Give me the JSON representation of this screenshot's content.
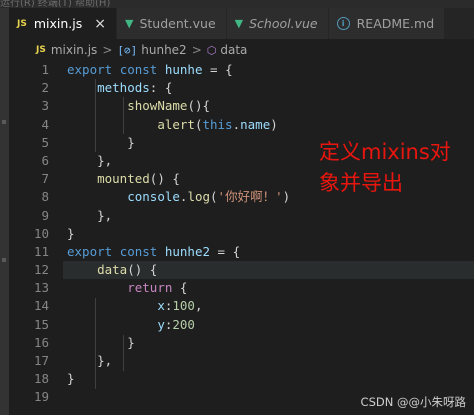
{
  "top_strip": {
    "text": "运行(R)  终端(T)  帮助(H)"
  },
  "tabs": [
    {
      "label": "mixin.js",
      "icon": "js-file-icon",
      "active": true,
      "italic": false,
      "closable": true
    },
    {
      "label": "Student.vue",
      "icon": "vue-file-icon",
      "active": false,
      "italic": false,
      "closable": false
    },
    {
      "label": "School.vue",
      "icon": "vue-file-icon",
      "active": false,
      "italic": true,
      "closable": false
    },
    {
      "label": "README.md",
      "icon": "info-file-icon",
      "active": false,
      "italic": false,
      "closable": false
    }
  ],
  "breadcrumb": {
    "file": "mixin.js",
    "sep": ">",
    "symbol": "hunhe2",
    "member": "data"
  },
  "line_numbers": [
    "1",
    "2",
    "3",
    "4",
    "5",
    "6",
    "7",
    "8",
    "9",
    "10",
    "11",
    "12",
    "13",
    "14",
    "15",
    "16",
    "17",
    "18",
    "19"
  ],
  "annotation": {
    "line1": "定义mixins对",
    "line2": "象并导出"
  },
  "watermark": "CSDN @@小朱呀路",
  "colors": {
    "background": "#1e1e1e",
    "keyword": "#569cd6",
    "property": "#9cdcfe",
    "function": "#dcdcaa",
    "string": "#ce9178",
    "number": "#b5cea8",
    "control": "#c586c0",
    "annotation": "#e8160e"
  }
}
